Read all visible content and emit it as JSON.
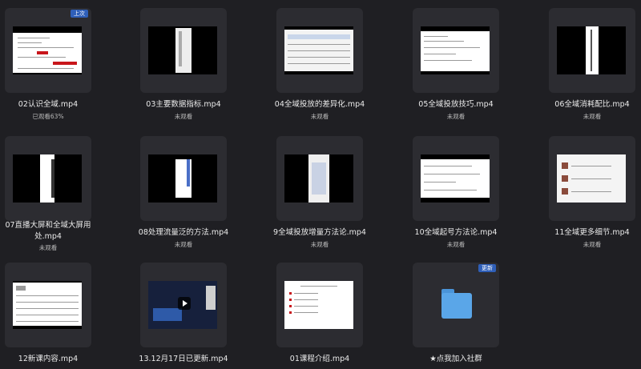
{
  "files": [
    {
      "name": "02认识全域.mp4",
      "status": "已观看63%",
      "badge": "上次"
    },
    {
      "name": "03主要数据指标.mp4",
      "status": "未观看"
    },
    {
      "name": "04全域投放的差异化.mp4",
      "status": "未观看"
    },
    {
      "name": "05全域投放技巧.mp4",
      "status": "未观看"
    },
    {
      "name": "06全域消耗配比.mp4",
      "status": "未观看"
    },
    {
      "name": "07直播大屏和全域大屏用处.mp4",
      "status": "未观看"
    },
    {
      "name": "08处理流量泛的方法.mp4",
      "status": "未观看"
    },
    {
      "name": "9全域投放增量方法论.mp4",
      "status": "未观看"
    },
    {
      "name": "10全域起号方法论.mp4",
      "status": "未观看"
    },
    {
      "name": "11全域更多细节.mp4",
      "status": "未观看"
    },
    {
      "name": "12新课内容.mp4",
      "status": ""
    },
    {
      "name": "13.12月17日已更新.mp4",
      "status": ""
    },
    {
      "name": "01课程介绍.mp4",
      "status": ""
    },
    {
      "name": "★点我加入社群",
      "status": "",
      "badge": "更新"
    }
  ]
}
